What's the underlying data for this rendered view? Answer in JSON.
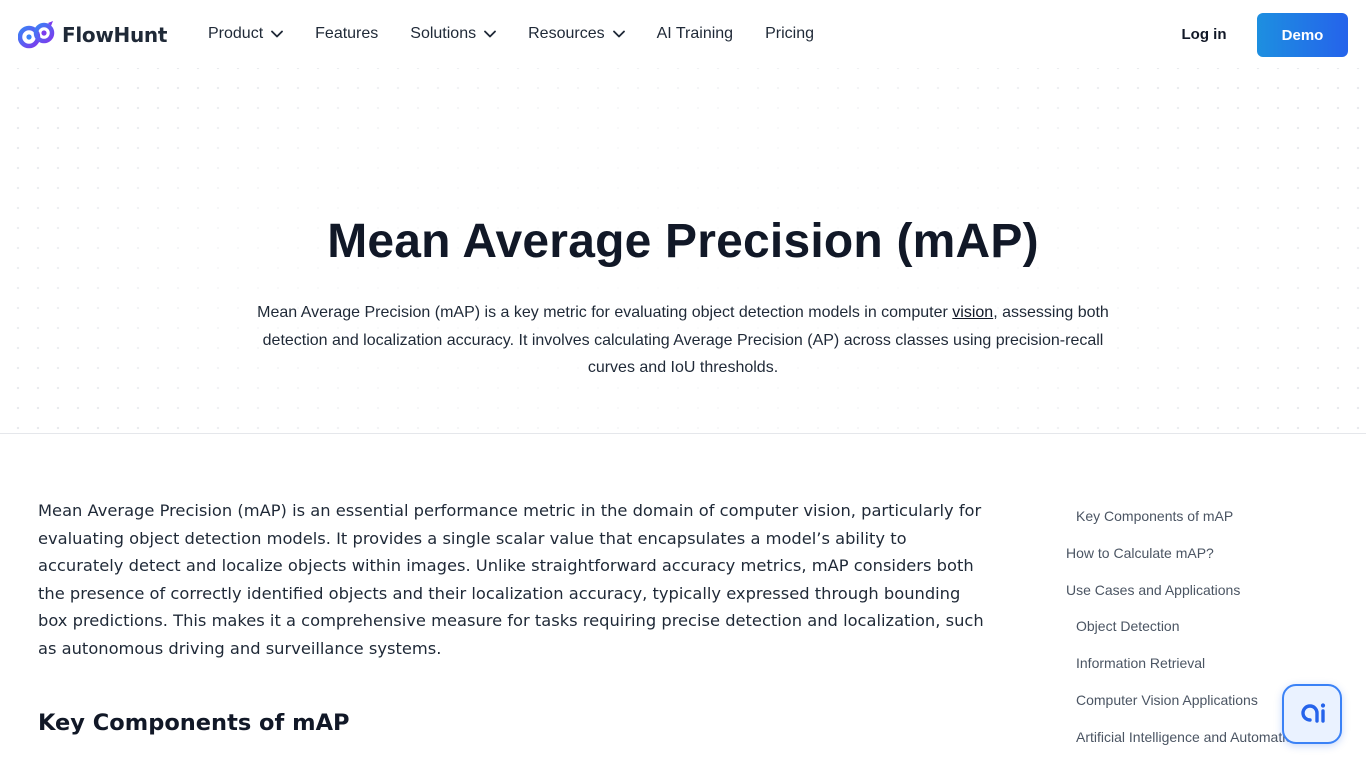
{
  "header": {
    "logo_text": "FlowHunt",
    "nav": [
      {
        "label": "Product",
        "has_dropdown": true
      },
      {
        "label": "Features",
        "has_dropdown": false
      },
      {
        "label": "Solutions",
        "has_dropdown": true
      },
      {
        "label": "Resources",
        "has_dropdown": true
      },
      {
        "label": "AI Training",
        "has_dropdown": false
      },
      {
        "label": "Pricing",
        "has_dropdown": false
      }
    ],
    "login_label": "Log in",
    "demo_label": "Demo"
  },
  "hero": {
    "title": "Mean Average Precision (mAP)",
    "desc_before": "Mean Average Precision (mAP) is a key metric for evaluating object detection models in computer ",
    "desc_link": "vision",
    "desc_after": ", assessing both detection and localization accuracy. It involves calculating Average Precision (AP) across classes using precision-recall curves and IoU thresholds."
  },
  "main": {
    "intro": "Mean Average Precision (mAP) is an essential performance metric in the domain of computer vision, particularly for evaluating object detection models. It provides a single scalar value that encapsulates a model’s ability to accurately detect and localize objects within images. Unlike straightforward accuracy metrics, mAP considers both the presence of correctly identified objects and their localization accuracy, typically expressed through bounding box predictions. This makes it a comprehensive measure for tasks requiring precise detection and localization, such as autonomous driving and surveillance systems.",
    "heading": "Key Components of mAP"
  },
  "toc": {
    "items": [
      {
        "label": "Key Components of mAP",
        "level": 2
      },
      {
        "label": "How to Calculate mAP?",
        "level": 1
      },
      {
        "label": "Use Cases and Applications",
        "level": 1
      },
      {
        "label": "Object Detection",
        "level": 2
      },
      {
        "label": "Information Retrieval",
        "level": 2
      },
      {
        "label": "Computer Vision Applications",
        "level": 2
      },
      {
        "label": "Artificial Intelligence and Automatio",
        "level": 2
      }
    ]
  },
  "colors": {
    "accent": "#2563eb",
    "logo_blue": "#3b82f6",
    "logo_purple": "#7c3aed"
  },
  "icons": {
    "logo": "flowhunt-logo-icon",
    "dropdown": "chevron-down-icon",
    "chat": "ai-chat-icon"
  }
}
